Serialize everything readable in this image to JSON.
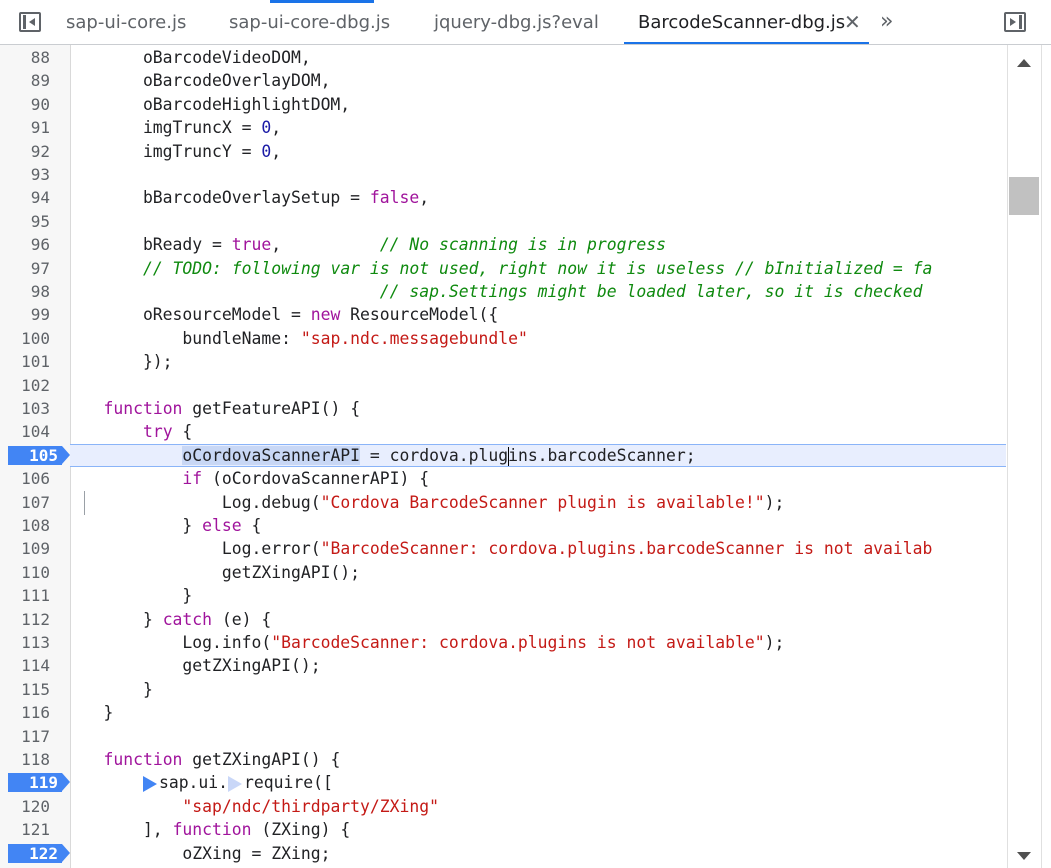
{
  "tabs": [
    {
      "label": "sap-ui-core.js",
      "active": false
    },
    {
      "label": "sap-ui-core-dbg.js",
      "active": false
    },
    {
      "label": "jquery-dbg.js?eval",
      "active": false
    },
    {
      "label": "BarcodeScanner-dbg.js",
      "active": true
    }
  ],
  "tab_close_glyph": "✕",
  "more_tabs_glyph": "»",
  "icons": {
    "left_panel": "toggle-navigator-icon",
    "right_panel": "toggle-debugger-icon"
  },
  "colors": {
    "accent": "#1a73e8",
    "breakpoint": "#4285f4",
    "keyword": "#a0149c",
    "string": "#c41a16",
    "comment": "#0f8a0f",
    "number": "#1a1aa6"
  },
  "lines": [
    {
      "n": "88",
      "bp": false,
      "code": "        oBarcodeVideoDOM,"
    },
    {
      "n": "89",
      "bp": false,
      "code": "        oBarcodeOverlayDOM,"
    },
    {
      "n": "90",
      "bp": false,
      "code": "        oBarcodeHighlightDOM,"
    },
    {
      "n": "91",
      "bp": false,
      "code": "        imgTruncX = 0,"
    },
    {
      "n": "92",
      "bp": false,
      "code": "        imgTruncY = 0,"
    },
    {
      "n": "93",
      "bp": false,
      "code": ""
    },
    {
      "n": "94",
      "bp": false,
      "code": "        bBarcodeOverlaySetup = false,"
    },
    {
      "n": "95",
      "bp": false,
      "code": ""
    },
    {
      "n": "96",
      "bp": false,
      "code": "        bReady = true,          // No scanning is in progress"
    },
    {
      "n": "97",
      "bp": false,
      "code": "        // TODO: following var is not used, right now it is useless // bInitialized = fa"
    },
    {
      "n": "98",
      "bp": false,
      "code": "                                // sap.Settings might be loaded later, so it is checked"
    },
    {
      "n": "99",
      "bp": false,
      "code": "        oResourceModel = new ResourceModel({"
    },
    {
      "n": "100",
      "bp": false,
      "code": "            bundleName: \"sap.ndc.messagebundle\""
    },
    {
      "n": "101",
      "bp": false,
      "code": "        });"
    },
    {
      "n": "102",
      "bp": false,
      "code": ""
    },
    {
      "n": "103",
      "bp": false,
      "code": "    function getFeatureAPI() {"
    },
    {
      "n": "104",
      "bp": false,
      "code": "        try {"
    },
    {
      "n": "105",
      "bp": true,
      "code": "            oCordovaScannerAPI = cordova.plugins.barcodeScanner;"
    },
    {
      "n": "106",
      "bp": false,
      "code": "            if (oCordovaScannerAPI) {"
    },
    {
      "n": "107",
      "bp": false,
      "code": "                Log.debug(\"Cordova BarcodeScanner plugin is available!\");"
    },
    {
      "n": "108",
      "bp": false,
      "code": "            } else {"
    },
    {
      "n": "109",
      "bp": false,
      "code": "                Log.error(\"BarcodeScanner: cordova.plugins.barcodeScanner is not availab"
    },
    {
      "n": "110",
      "bp": false,
      "code": "                getZXingAPI();"
    },
    {
      "n": "111",
      "bp": false,
      "code": "            }"
    },
    {
      "n": "112",
      "bp": false,
      "code": "        } catch (e) {"
    },
    {
      "n": "113",
      "bp": false,
      "code": "            Log.info(\"BarcodeScanner: cordova.plugins is not available\");"
    },
    {
      "n": "114",
      "bp": false,
      "code": "            getZXingAPI();"
    },
    {
      "n": "115",
      "bp": false,
      "code": "        }"
    },
    {
      "n": "116",
      "bp": false,
      "code": "    }"
    },
    {
      "n": "117",
      "bp": false,
      "code": ""
    },
    {
      "n": "118",
      "bp": false,
      "code": "    function getZXingAPI() {"
    },
    {
      "n": "119",
      "bp": true,
      "code": "        sap.ui.require(["
    },
    {
      "n": "120",
      "bp": false,
      "code": "            \"sap/ndc/thirdparty/ZXing\""
    },
    {
      "n": "121",
      "bp": false,
      "code": "        ], function (ZXing) {"
    },
    {
      "n": "122",
      "bp": true,
      "code": "            oZXing = ZXing;"
    }
  ]
}
